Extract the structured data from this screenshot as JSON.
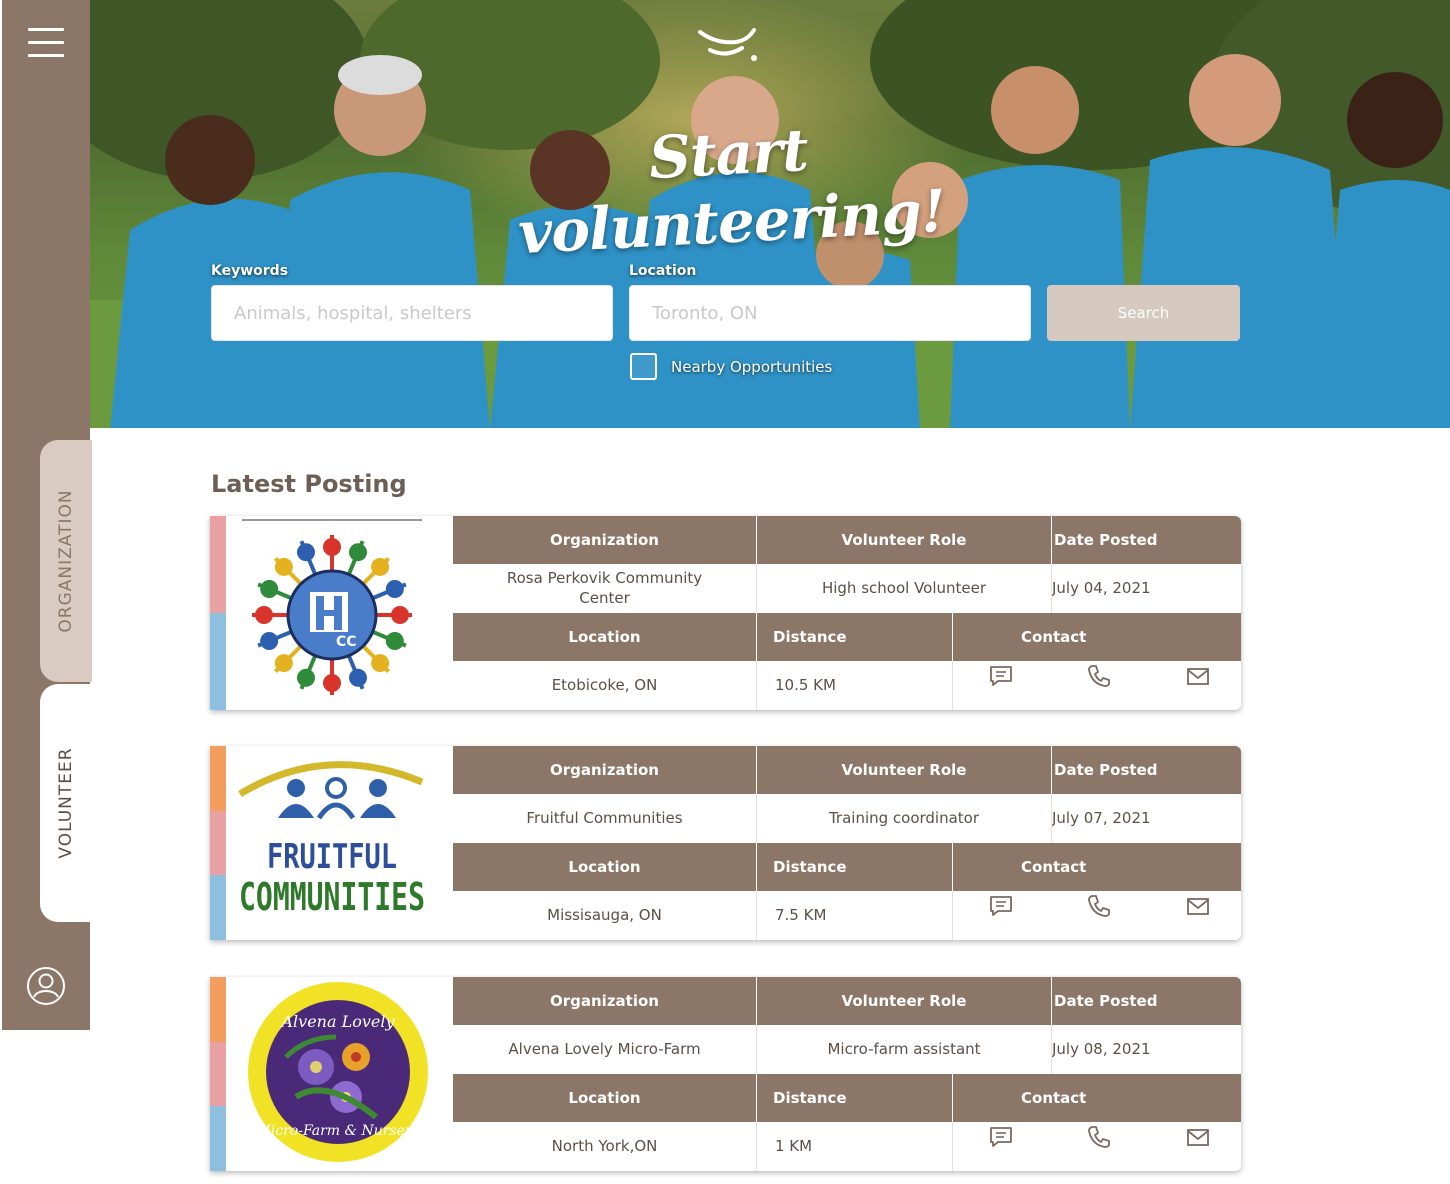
{
  "brand": {
    "accent": "#8b7668",
    "tab_inactive": "#d9cac2",
    "button": "#d6c9c0"
  },
  "sidebar": {
    "menu_icon": "hamburger-menu-icon",
    "tabs": [
      {
        "label": "ORGANIZATION",
        "active": false
      },
      {
        "label": "VOLUNTEER",
        "active": true
      }
    ],
    "profile_icon": "user-profile-icon"
  },
  "hero": {
    "title": "Start volunteering!",
    "keywords": {
      "label": "Keywords",
      "placeholder": "Animals, hospital, shelters"
    },
    "location": {
      "label": "Location",
      "placeholder": "Toronto, ON"
    },
    "search_label": "Search",
    "nearby_label": "Nearby Opportunities",
    "nearby_checked": false
  },
  "main": {
    "section_title": "Latest Posting",
    "headers": {
      "organization": "Organization",
      "role": "Volunteer Role",
      "date": "Date Posted",
      "location": "Location",
      "distance": "Distance",
      "contact": "Contact"
    },
    "contact_icons": [
      "chat-icon",
      "phone-icon",
      "mail-icon"
    ],
    "postings": [
      {
        "organization": "Rosa Perkovik Community Center",
        "role": "High school Volunteer",
        "date": "July 04, 2021",
        "location": "Etobicoke, ON",
        "distance": "10.5 KM",
        "logo_text": "CC",
        "stripes": [
          "#eaa1a3",
          "#8ebfdf"
        ]
      },
      {
        "organization": "Fruitful Communities",
        "role": "Training coordinator",
        "date": "July 07, 2021",
        "location": "Missisauga, ON",
        "distance": "7.5 KM",
        "logo_text": "FRUITFUL COMMUNITIES",
        "stripes": [
          "#f39d5f",
          "#eaa1a3",
          "#8ebfdf"
        ]
      },
      {
        "organization": "Alvena Lovely Micro-Farm",
        "role": "Micro-farm assistant",
        "date": "July 08, 2021",
        "location": "North York,ON",
        "distance": "1 KM",
        "logo_text": "Alvena Lovely Micro-Farm & Nursery",
        "stripes": [
          "#f39d5f",
          "#eaa1a3",
          "#8ebfdf"
        ]
      }
    ]
  }
}
